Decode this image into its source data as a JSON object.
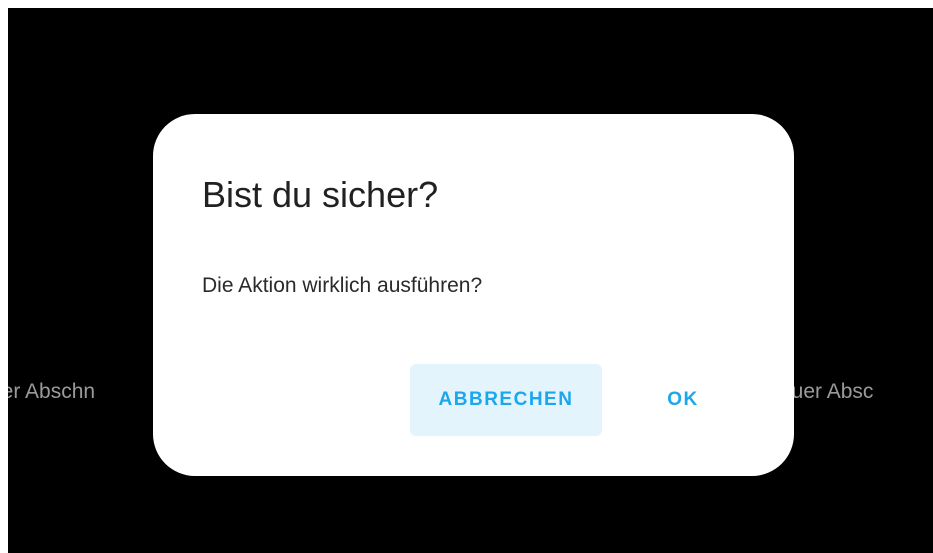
{
  "background": {
    "left_label": "uer Abschn",
    "right_label": "euer Absc"
  },
  "dialog": {
    "title": "Bist du sicher?",
    "message": "Die Aktion wirklich ausführen?",
    "cancel_label": "ABBRECHEN",
    "ok_label": "OK"
  },
  "colors": {
    "backdrop": "#000000",
    "dialog_bg": "#ffffff",
    "accent": "#1aa7ec",
    "cancel_bg": "#e3f4fd"
  }
}
